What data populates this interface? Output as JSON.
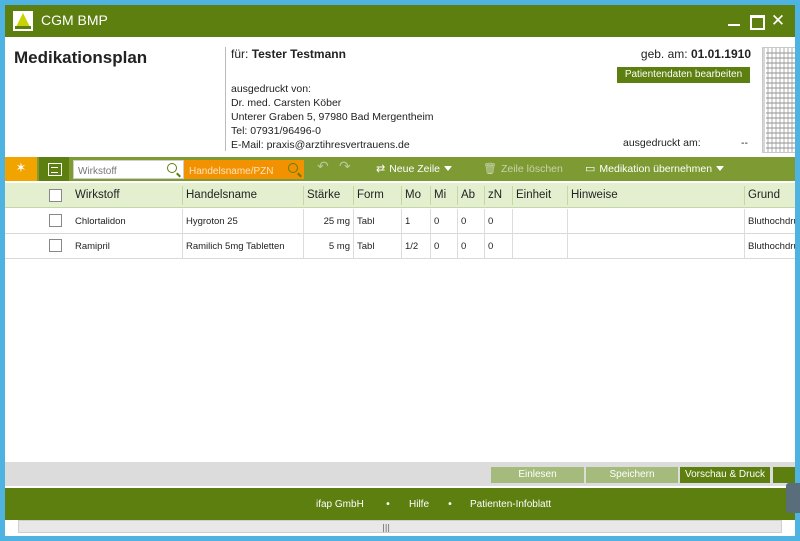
{
  "window": {
    "title": "CGM BMP"
  },
  "header": {
    "plan_title": "Medikationsplan",
    "patient_prefix": "für:",
    "patient_name": "Tester Testmann",
    "dob_label": "geb. am:",
    "dob": "01.01.1910",
    "edit_button": "Patientendaten bearbeiten",
    "printed_by_label": "ausgedruckt von:",
    "doctor": "Dr. med. Carsten Köber",
    "street": "Unterer Graben 5, 97980 Bad Mergentheim",
    "phone": "Tel: 07931/96496-0",
    "email": "E-Mail: praxis@arztihresvertrauens.de",
    "printed_on_label": "ausgedruckt am:",
    "printed_on_value": "--"
  },
  "toolbar": {
    "wirkstoff_placeholder": "Wirkstoff",
    "handelsname_placeholder": "Handelsname/PZN",
    "new_row": "Neue Zeile",
    "delete_row": "Zeile löschen",
    "take_medication": "Medikation übernehmen"
  },
  "table": {
    "columns": [
      "Wirkstoff",
      "Handelsname",
      "Stärke",
      "Form",
      "Mo",
      "Mi",
      "Ab",
      "zN",
      "Einheit",
      "Hinweise",
      "Grund"
    ],
    "rows": [
      {
        "wirkstoff": "Chlortalidon",
        "handelsname": "Hygroton 25",
        "staerke": "25 mg",
        "form": "Tabl",
        "mo": "1",
        "mi": "0",
        "ab": "0",
        "zn": "0",
        "einheit": "",
        "hinweise": "",
        "grund": "Bluthochdruck"
      },
      {
        "wirkstoff": "Ramipril",
        "handelsname": "Ramilich 5mg Tabletten",
        "staerke": "5 mg",
        "form": "Tabl",
        "mo": "1/2",
        "mi": "0",
        "ab": "0",
        "zn": "0",
        "einheit": "",
        "hinweise": "",
        "grund": "Bluthochdruck"
      }
    ]
  },
  "actions": {
    "einlesen": "Einlesen",
    "speichern": "Speichern",
    "vorschau": "Vorschau & Druck"
  },
  "footer": {
    "links": [
      "ifap GmbH",
      "Hilfe",
      "Patienten-Infoblatt"
    ],
    "separator": "•"
  },
  "colors": {
    "primary": "#5c7f10",
    "toolbar": "#7e9a33",
    "accent_orange": "#f39200",
    "header_row": "#e3efcf"
  }
}
